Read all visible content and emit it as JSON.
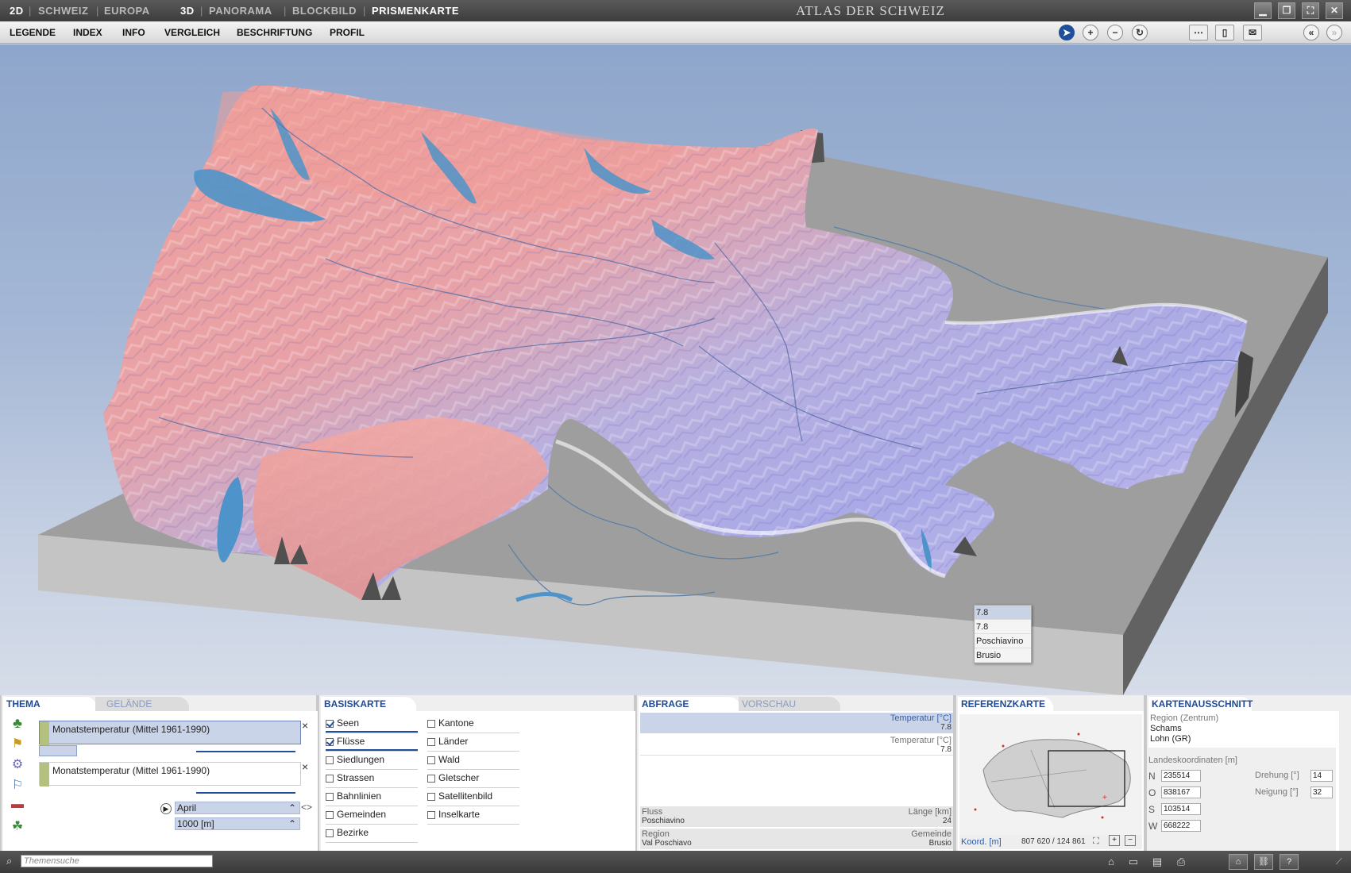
{
  "titlebar": {
    "modes": [
      "2D",
      "SCHWEIZ",
      "EUROPA",
      "3D",
      "PANORAMA",
      "BLOCKBILD",
      "PRISMENKARTE"
    ],
    "app_title": "ATLAS DER SCHWEIZ"
  },
  "menu": [
    "LEGENDE",
    "INDEX",
    "INFO",
    "VERGLEICH",
    "BESCHRIFTUNG",
    "PROFIL"
  ],
  "tooltip": [
    "7.8",
    "7.8",
    "Poschiavino",
    "Brusio"
  ],
  "thema": {
    "tab_active": "THEMA",
    "tab_inactive": "GELÄNDE",
    "layer1": "Monatstemperatur (Mittel 1961-1990)",
    "layer2": "Monatstemperatur (Mittel 1961-1990)",
    "close": "×",
    "month": "April",
    "height": "1000 [m]"
  },
  "basiskarte": {
    "title": "BASISKARTE",
    "col1": [
      {
        "label": "Seen",
        "checked": true
      },
      {
        "label": "Flüsse",
        "checked": true
      },
      {
        "label": "Siedlungen",
        "checked": false
      },
      {
        "label": "Strassen",
        "checked": false
      },
      {
        "label": "Bahnlinien",
        "checked": false
      },
      {
        "label": "Gemeinden",
        "checked": false
      },
      {
        "label": "Bezirke",
        "checked": false
      }
    ],
    "col2": [
      {
        "label": "Kantone",
        "checked": false
      },
      {
        "label": "Länder",
        "checked": false
      },
      {
        "label": "Wald",
        "checked": false
      },
      {
        "label": "Gletscher",
        "checked": false
      },
      {
        "label": "Satellitenbild",
        "checked": false
      },
      {
        "label": "Inselkarte",
        "checked": false
      }
    ]
  },
  "abfrage": {
    "tab_active": "ABFRAGE",
    "tab_inactive": "VORSCHAU",
    "rows": [
      {
        "label": "Temperatur [°C]",
        "value": "7.8"
      },
      {
        "label": "Temperatur [°C]",
        "value": "7.8"
      }
    ],
    "fluss_label": "Fluss",
    "fluss_value": "Poschiavino",
    "laenge_label": "Länge [km]",
    "laenge_value": "24",
    "region_label": "Region",
    "region_value": "Val Poschiavo",
    "gemeinde_label": "Gemeinde",
    "gemeinde_value": "Brusio"
  },
  "referenzkarte": {
    "title": "REFERENZKARTE",
    "koord_label": "Koord. [m]",
    "koord_value": "807 620 / 124 861"
  },
  "kartenausschnitt": {
    "title": "KARTENAUSSCHNITT",
    "region_label": "Region (Zentrum)",
    "region1": "Schams",
    "region2": "Lohn (GR)",
    "coords_label": "Landeskoordinaten [m]",
    "N": "235514",
    "O": "838167",
    "S": "103514",
    "W": "668222",
    "drehung_label": "Drehung [°]",
    "drehung": "14",
    "neigung_label": "Neigung [°]",
    "neigung": "32"
  },
  "status": {
    "search_placeholder": "Themensuche"
  },
  "colors": {
    "accent": "#214a92",
    "warm": "#e89a96",
    "cold": "#9fa6e0",
    "lake": "#4e93c9"
  }
}
